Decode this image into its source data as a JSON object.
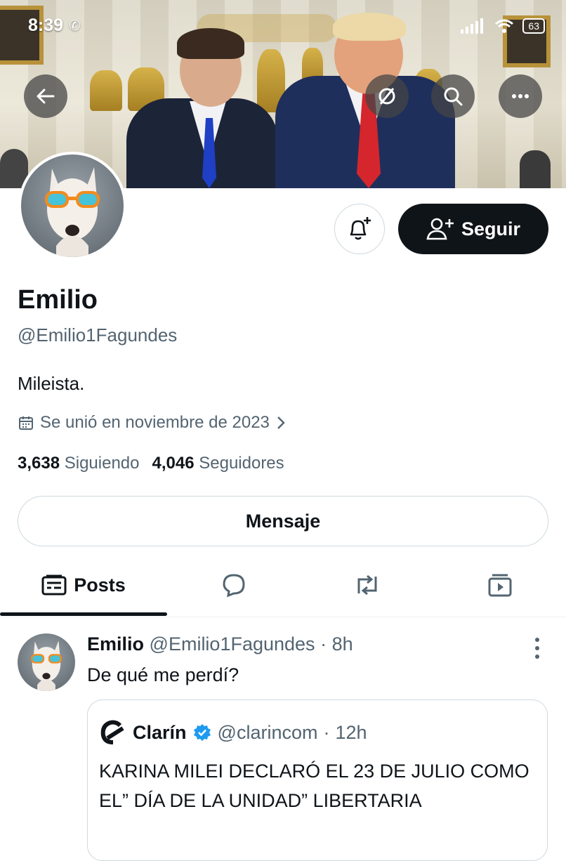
{
  "status_bar": {
    "time": "8:39",
    "battery": "63"
  },
  "profile": {
    "name": "Emilio",
    "handle": "@Emilio1Fagundes",
    "bio": "Mileista.",
    "joined": "Se unió en noviembre de 2023",
    "following_count": "3,638",
    "following_label": "Siguiendo",
    "followers_count": "4,046",
    "followers_label": "Seguidores"
  },
  "actions": {
    "follow_label": "Seguir",
    "message_label": "Mensaje"
  },
  "tabs": [
    {
      "label": "Posts",
      "icon": "posts-icon"
    },
    {
      "icon": "replies-icon"
    },
    {
      "icon": "repost-icon"
    },
    {
      "icon": "media-icon"
    }
  ],
  "post": {
    "author": "Emilio",
    "handle": "@Emilio1Fagundes",
    "time": "8h",
    "text": "De qué me perdí?",
    "quote": {
      "author": "Clarín",
      "handle": "@clarincom",
      "time": "12h",
      "text": "KARINA MILEI DECLARÓ EL 23 DE JULIO COMO EL” DÍA DE LA UNIDAD” LIBERTARIA"
    }
  },
  "colors": {
    "accent": "#0f1419",
    "verified": "#1d9bf0",
    "secondary_text": "#536471"
  }
}
